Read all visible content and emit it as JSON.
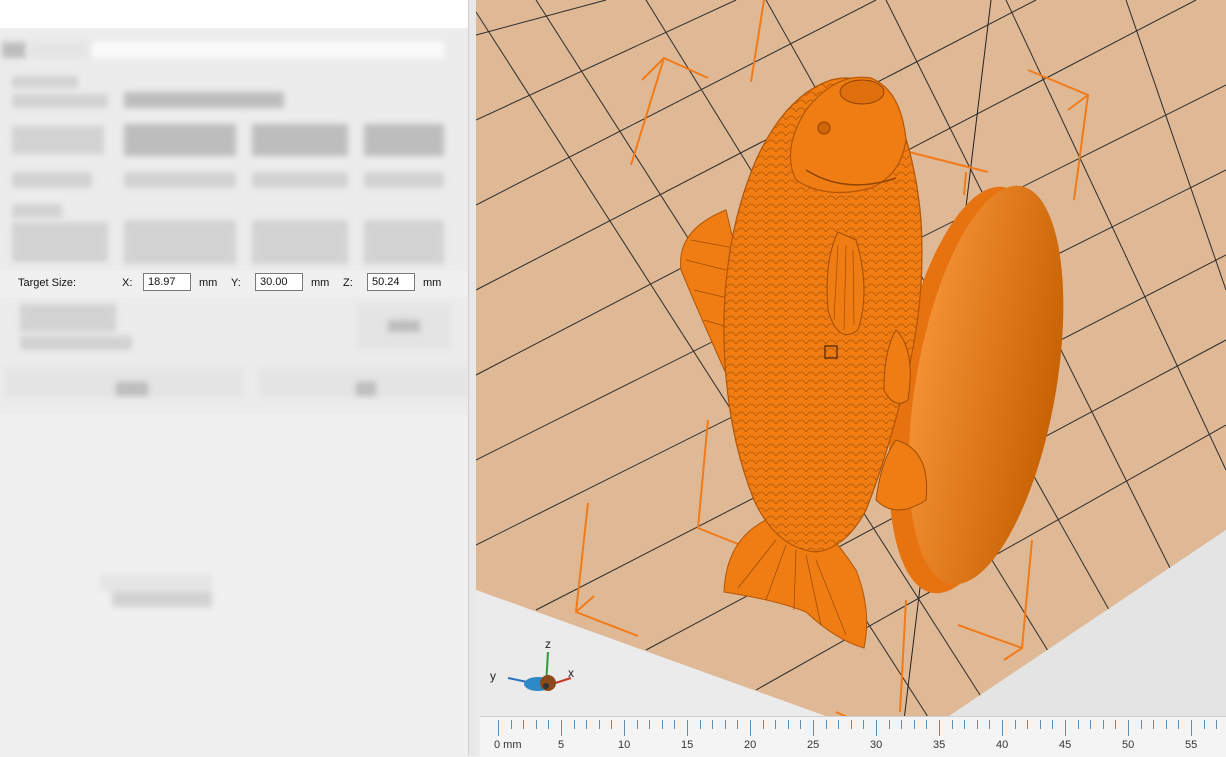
{
  "target_size": {
    "label": "Target Size:",
    "x_label": "X:",
    "x_value": "18.97",
    "y_label": "Y:",
    "y_value": "30.00",
    "z_label": "Z:",
    "z_value": "50.24",
    "unit": "mm"
  },
  "axis_gizmo": {
    "x": "x",
    "y": "y",
    "z": "z"
  },
  "ruler": {
    "labels": [
      "0 mm",
      "5",
      "10",
      "15",
      "20",
      "25",
      "30",
      "35",
      "40",
      "45",
      "50",
      "55"
    ]
  },
  "colors": {
    "model": "#f07d13",
    "model_dark": "#c75e05",
    "bed": "#dfb996",
    "grid_line": "#2f2f2f",
    "bbox": "#f27a18",
    "ruler_tick": "#5b8fb8"
  }
}
